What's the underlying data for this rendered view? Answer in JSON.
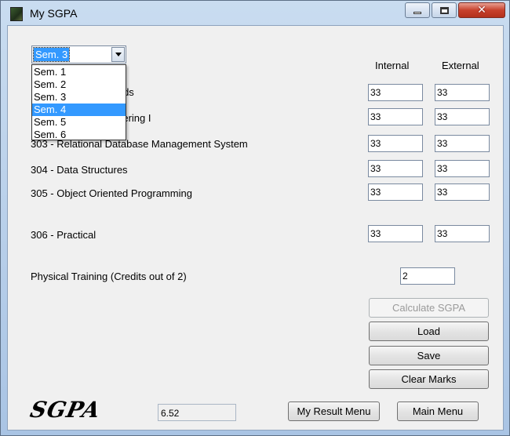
{
  "window": {
    "title": "My SGPA",
    "controls": {
      "minimize": "minimize",
      "maximize": "maximize",
      "close": "✕"
    }
  },
  "semester": {
    "selected": "Sem. 3",
    "options": [
      "Sem. 1",
      "Sem. 2",
      "Sem. 3",
      "Sem. 4",
      "Sem. 5",
      "Sem. 6"
    ],
    "highlighted": "Sem. 4"
  },
  "headers": {
    "internal": "Internal",
    "external": "External"
  },
  "subjects": [
    {
      "label": "thods",
      "internal": "33",
      "external": "33"
    },
    {
      "label": "ineering I",
      "internal": "33",
      "external": "33"
    },
    {
      "label": "303 - Relational Database Management System",
      "internal": "33",
      "external": "33"
    },
    {
      "label": "304 - Data Structures",
      "internal": "33",
      "external": "33"
    },
    {
      "label": "305 - Object Oriented Programming",
      "internal": "33",
      "external": "33"
    },
    {
      "label": "306 - Practical",
      "internal": "33",
      "external": "33"
    }
  ],
  "physical_training": {
    "label": "Physical Training (Credits out of 2)",
    "value": "2"
  },
  "buttons": {
    "calculate": "Calculate SGPA",
    "load": "Load",
    "save": "Save",
    "clear": "Clear Marks",
    "result_menu": "My Result Menu",
    "main_menu": "Main Menu"
  },
  "sgpa": {
    "logo": "SGPA",
    "value": "6.52"
  }
}
